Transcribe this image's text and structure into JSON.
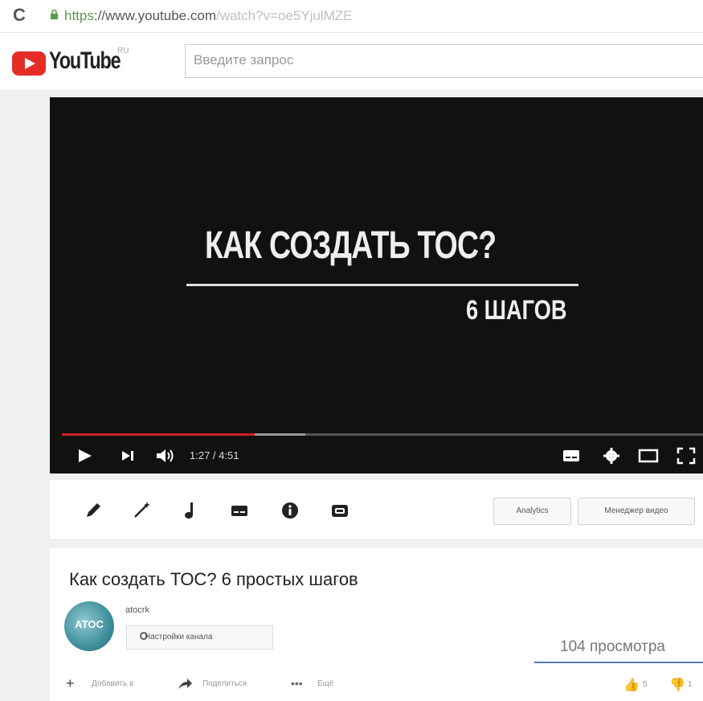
{
  "browser": {
    "url_protocol": "https",
    "url_host": "://www.youtube.com",
    "url_path": "/watch?v=oe5YjulMZE"
  },
  "header": {
    "logo_text": "YouTube",
    "logo_region": "RU",
    "search_placeholder": "Введите запрос"
  },
  "player": {
    "title": "КАК СОЗДАТЬ ТОС?",
    "subtitle": "6 ШАГОВ",
    "time": "1:27 / 4:51",
    "progress_played": 0.3,
    "progress_buffered": 0.38
  },
  "toolbar": {
    "tools": [
      "pencil-icon",
      "magic-wand-icon",
      "music-note-icon",
      "subtitles-icon",
      "info-icon",
      "annotations-icon"
    ],
    "analytics_label": "Analytics",
    "video_manager_label": "Менеджер видео"
  },
  "video": {
    "title": "Как создать ТОС? 6 простых шагов",
    "channel_name": "atocrk",
    "avatar_text": "АТОС",
    "channel_settings_label": "Настройки канала",
    "views": "104 просмотра",
    "add_to_label": "Добавить в",
    "share_label": "Поделиться",
    "more_label": "Ещё",
    "like_count": "5",
    "dislike_count": "1"
  },
  "colors": {
    "brand_red": "#e52d27",
    "progress_red": "#d02020",
    "like_blue": "#3b6ec0"
  }
}
